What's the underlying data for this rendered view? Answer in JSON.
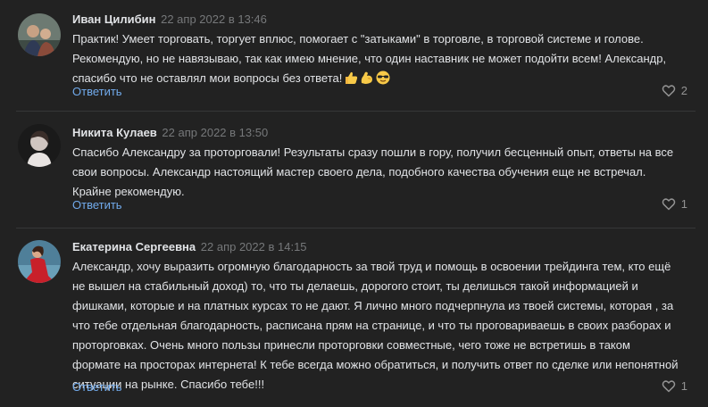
{
  "comments": [
    {
      "author": "Иван Цилибин",
      "date": "22 апр 2022 в 13:46",
      "lines": [
        "Практик! Умеет торговать, торгует вплюс, помогает с \"затыками\" в торговле, в торговой системе и голове.",
        "Рекомендую, но не навязываю, так как имею мнение, что один наставник не может подойти всем! Александр,",
        "спасибо что не оставлял мои вопросы без ответа!"
      ],
      "emojis": [
        "thumbs-up-emoji",
        "flexed-biceps-emoji",
        "sunglasses-emoji"
      ],
      "reply_label": "Ответить",
      "likes": "2"
    },
    {
      "author": "Никита Кулаев",
      "date": "22 апр 2022 в 13:50",
      "lines": [
        "Спасибо Александру за проторговали! Результаты сразу пошли в гору, получил бесценный опыт, ответы на все",
        "свои вопросы. Александр настоящий мастер своего дела, подобного качества обучения еще не встречал.",
        "Крайне рекомендую."
      ],
      "reply_label": "Ответить",
      "likes": "1"
    },
    {
      "author": "Екатерина Сергеевна",
      "date": "22 апр 2022 в 14:15",
      "lines": [
        "Александр, хочу выразить огромную благодарность за твой труд и помощь в освоении трейдинга тем, кто ещё",
        "не вышел на стабильный доход) то, что ты делаешь, дорогого стоит, ты делишься такой информацией и",
        "фишками, которые и на платных курсах то не дают. Я лично много подчерпнула из твоей системы, которая , за",
        "что тебе отдельная благодарность, расписана прям на странице, и что ты проговариваешь в своих разборах и",
        "проторговках. Очень много пользы принесли проторговки совместные, чего тоже не встретишь в таком",
        "формате на просторах интернета! К тебе всегда можно обратиться, и получить ответ по сделке или непонятной",
        "ситуации на рынке. Спасибо тебе!!!"
      ],
      "reply_label": "Ответить",
      "likes": "1"
    }
  ],
  "icons": {
    "like": "heart-outline-icon"
  },
  "colors": {
    "background": "#222222",
    "link": "#71aaeb",
    "muted": "#76787a",
    "text": "#e1e3e6"
  }
}
